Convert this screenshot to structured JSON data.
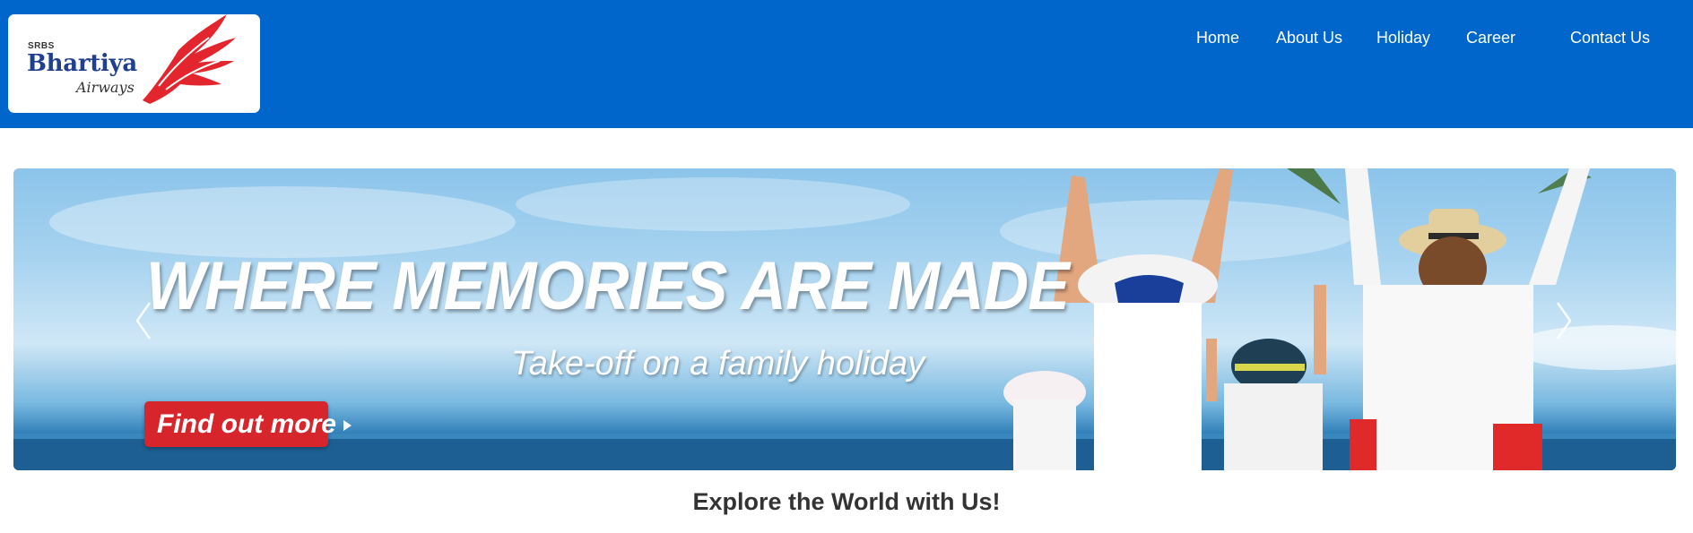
{
  "brand": {
    "prefix": "SRBS",
    "name": "Bhartiya",
    "tagline": "Airways",
    "colors": {
      "header": "#0066cc",
      "wing": "#e3262d",
      "wordmark": "#1f3f8f"
    }
  },
  "nav": {
    "items": [
      {
        "label": "Home"
      },
      {
        "label": "About Us"
      },
      {
        "label": "Holiday"
      },
      {
        "label": "Career"
      },
      {
        "label": "Contact Us"
      }
    ]
  },
  "banner": {
    "headline": "WHERE MEMORIES ARE MADE",
    "subline": "Take-off on a family holiday",
    "cta_label": "Find out more",
    "cta_color": "#d6262c",
    "prev_icon": "chevron-left-icon",
    "next_icon": "chevron-right-icon"
  },
  "section": {
    "title": "Explore the World with Us!"
  }
}
